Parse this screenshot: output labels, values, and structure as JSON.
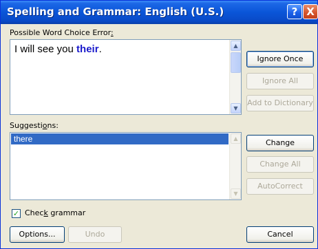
{
  "dialog": {
    "title": "Spelling and Grammar: English (U.S.)",
    "help_glyph": "?",
    "close_glyph": "X"
  },
  "error_section": {
    "label": "Possible Word Choice Error",
    "label_suffix": ":",
    "text_before": "I will see you ",
    "highlighted_word": "their",
    "text_after": "."
  },
  "suggestions_section": {
    "label_part1": "Suggesti",
    "label_underlined": "o",
    "label_part2": "ns:",
    "items": [
      "there"
    ]
  },
  "buttons": {
    "ignore_once": {
      "label": "Ignore Once",
      "enabled": true
    },
    "ignore_all": {
      "label": "Ignore All",
      "enabled": false
    },
    "add_to_dictionary": {
      "label": "Add to Dictionary",
      "enabled": false
    },
    "change": {
      "label": "Change",
      "enabled": true
    },
    "change_all": {
      "label": "Change All",
      "enabled": false
    },
    "autocorrect": {
      "label": "AutoCorrect",
      "enabled": false
    },
    "options": {
      "label": "Options...",
      "enabled": true
    },
    "undo": {
      "label": "Undo",
      "enabled": false
    },
    "cancel": {
      "label": "Cancel",
      "enabled": true
    }
  },
  "check_grammar": {
    "checked": true,
    "label_part1": "Chec",
    "label_underlined": "k",
    "label_part2": " grammar"
  },
  "colors": {
    "title_bar": "#0a55d8",
    "highlight_word": "#1a1acb",
    "selection": "#316ac5"
  }
}
